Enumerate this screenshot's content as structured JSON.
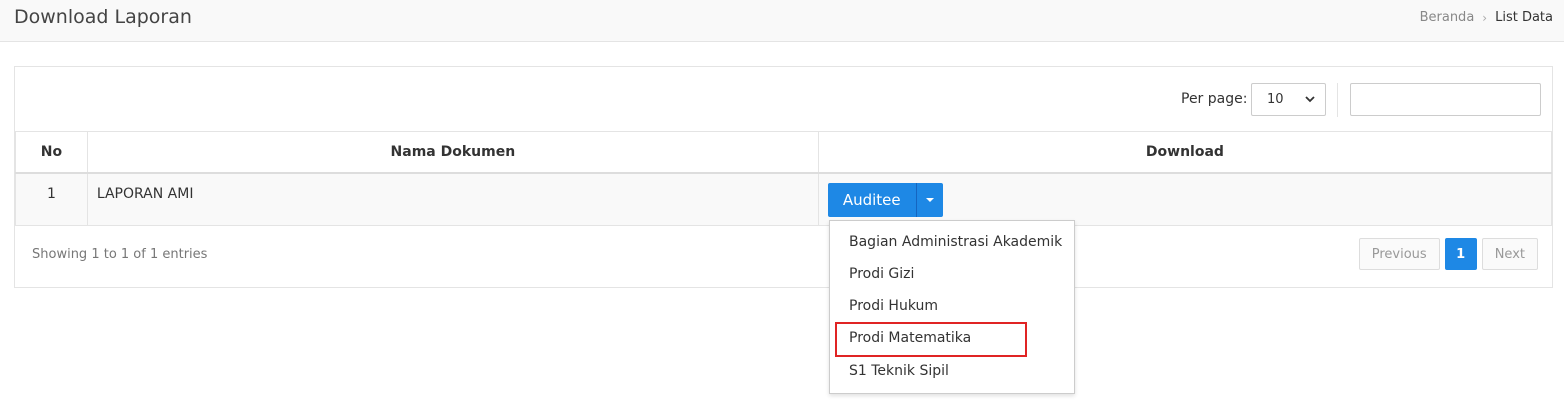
{
  "header": {
    "title": "Download Laporan",
    "breadcrumb": [
      "Beranda",
      "List Data"
    ]
  },
  "toolbar": {
    "per_page_label": "Per page:",
    "per_page_value": "10",
    "search_value": ""
  },
  "table": {
    "columns": [
      "No",
      "Nama Dokumen",
      "Download"
    ],
    "rows": [
      {
        "no": "1",
        "nama": "LAPORAN AMI",
        "button_label": "Auditee"
      }
    ]
  },
  "dropdown": {
    "items": [
      "Bagian Administrasi Akademik",
      "Prodi Gizi",
      "Prodi Hukum",
      "Prodi Matematika",
      "S1 Teknik Sipil"
    ],
    "highlighted": "Prodi Matematika"
  },
  "footer": {
    "info": "Showing 1 to 1 of 1 entries",
    "pagination": {
      "previous": "Previous",
      "current": "1",
      "next": "Next"
    }
  },
  "colors": {
    "primary": "#1e88e5",
    "highlight": "#e02424"
  }
}
